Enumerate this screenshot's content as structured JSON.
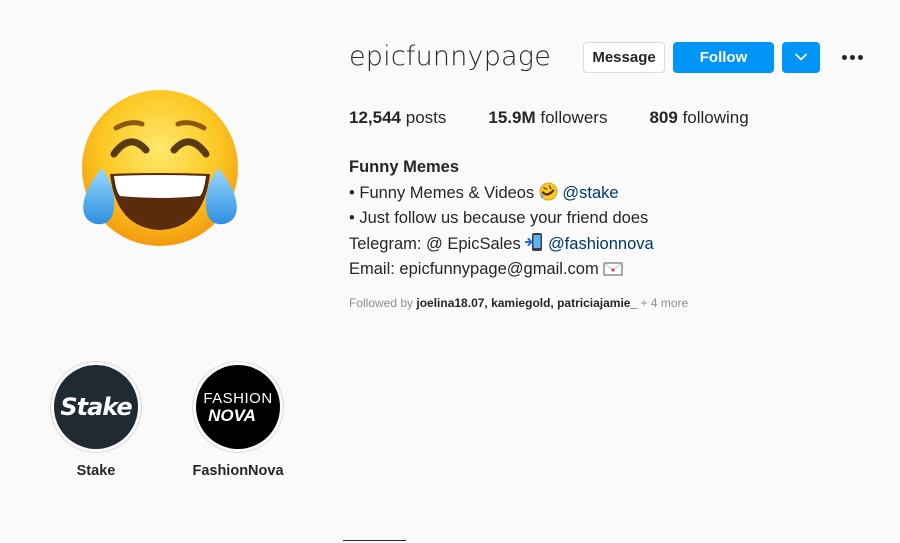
{
  "profile": {
    "username": "epicfunnypage",
    "avatar_icon": "face-with-tears-of-joy-emoji"
  },
  "actions": {
    "message_label": "Message",
    "follow_label": "Follow",
    "dropdown_icon": "chevron-down-icon",
    "more_icon": "more-options-icon"
  },
  "stats": {
    "posts_count": "12,544",
    "posts_label": "posts",
    "followers_count": "15.9M",
    "followers_label": "followers",
    "following_count": "809",
    "following_label": "following"
  },
  "bio": {
    "name": "Funny Memes",
    "line1_text": "• Funny Memes & Videos",
    "line1_mention": "@stake",
    "line2_text": "• Just follow us because your friend does",
    "line3_text": "Telegram: @ EpicSales",
    "line3_mention": "@fashionnova",
    "line4_text": "Email: epicfunnypage@gmail.com"
  },
  "followed_by": {
    "prefix": "Followed by",
    "users": "joelina18.07, kamiegold, patriciajamie_",
    "more": "+ 4 more"
  },
  "highlights": [
    {
      "label": "Stake",
      "logo_text": "Stake"
    },
    {
      "label": "FashionNova",
      "logo_top": "FASHION",
      "logo_bottom": "NOVA"
    }
  ],
  "colors": {
    "follow_blue": "#0095f6",
    "mention_blue": "#00376b",
    "background": "#fafafa"
  }
}
